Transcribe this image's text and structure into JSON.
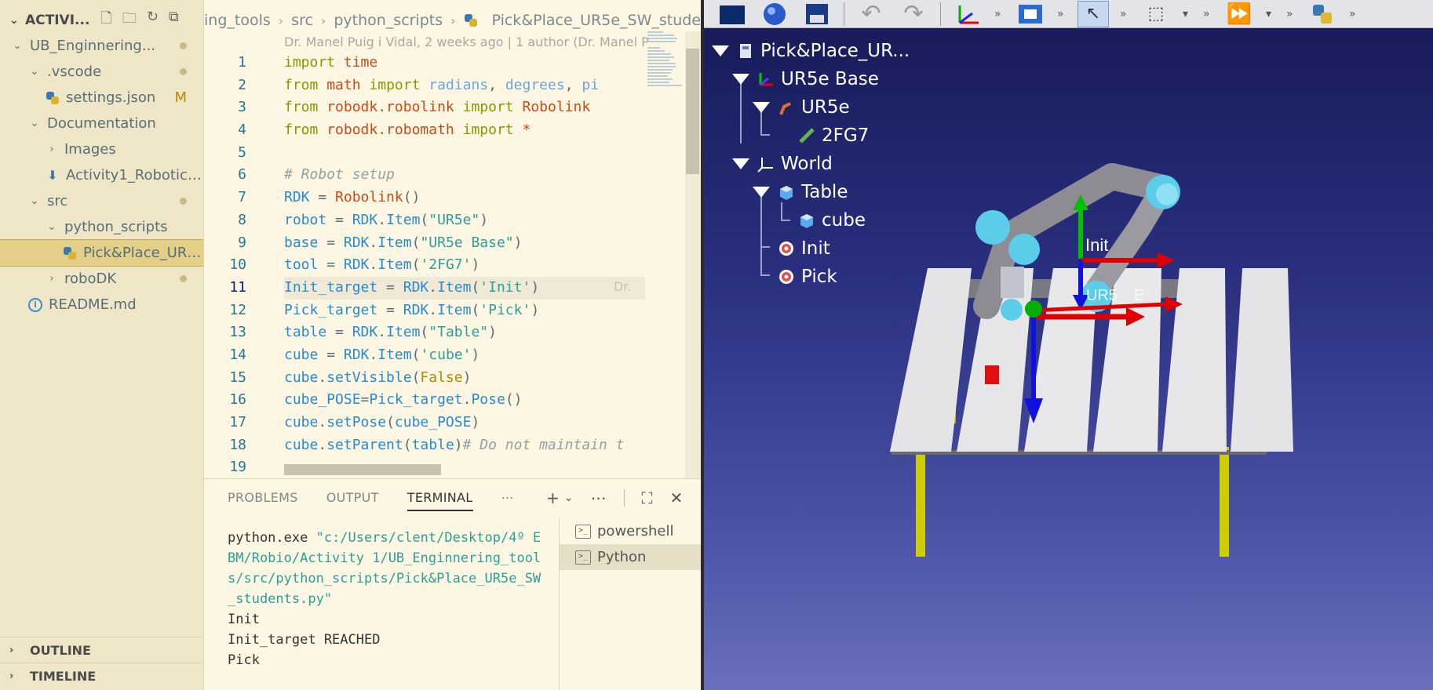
{
  "sidebar": {
    "header": "ACTIVI...",
    "items": [
      {
        "label": "UB_Enginnering...",
        "indent": 0,
        "twisty": "expanded",
        "badge": "dot"
      },
      {
        "label": ".vscode",
        "indent": 1,
        "twisty": "expanded",
        "badge": "dot"
      },
      {
        "label": "settings.json",
        "indent": 2,
        "twisty": "none",
        "icon": "python-icon",
        "badge": "M"
      },
      {
        "label": "Documentation",
        "indent": 1,
        "twisty": "expanded",
        "badge": ""
      },
      {
        "label": "Images",
        "indent": 2,
        "twisty": "collapsed",
        "badge": ""
      },
      {
        "label": "Activity1_Robotic_E...",
        "indent": 2,
        "twisty": "none",
        "icon": "download-icon",
        "badge": ""
      },
      {
        "label": "src",
        "indent": 1,
        "twisty": "expanded",
        "badge": "dot"
      },
      {
        "label": "python_scripts",
        "indent": 2,
        "twisty": "expanded",
        "badge": ""
      },
      {
        "label": "Pick&Place_UR5e...",
        "indent": 3,
        "twisty": "none",
        "icon": "python-icon",
        "badge": "",
        "selected": true
      },
      {
        "label": "roboDK",
        "indent": 2,
        "twisty": "collapsed",
        "badge": "dot"
      },
      {
        "label": "README.md",
        "indent": 1,
        "twisty": "none",
        "icon": "info-icon",
        "badge": ""
      }
    ],
    "outline": "OUTLINE",
    "timeline": "TIMELINE"
  },
  "editor": {
    "breadcrumb": [
      "ing_tools",
      "src",
      "python_scripts",
      "Pick&Place_UR5e_SW_students.py"
    ],
    "blame_header": "Dr. Manel Puig i Vidal, 2 weeks ago | 1 author (Dr. Manel P",
    "inline_blame": "Dr.",
    "line_numbers": [
      "1",
      "2",
      "3",
      "4",
      "5",
      "6",
      "7",
      "8",
      "9",
      "10",
      "11",
      "12",
      "13",
      "14",
      "15",
      "16",
      "17",
      "18",
      "19"
    ]
  },
  "panel": {
    "tabs": [
      "PROBLEMS",
      "OUTPUT",
      "TERMINAL"
    ],
    "active_tab": "TERMINAL",
    "terminal_cmd": "python.exe ",
    "terminal_path": "\"c:/Users/clent/Desktop/4º EBM/Robio/Activity 1/UB_Enginnering_tools/src/python_scripts/Pick&Place_UR5e_SW_students.py\"",
    "terminal_output": [
      "Init",
      "Init_target REACHED",
      "Pick"
    ],
    "terminals": [
      "powershell",
      "Python"
    ]
  },
  "robodk": {
    "tree": [
      {
        "label": "Pick&Place_UR...",
        "indent": 0,
        "icon": "station-icon",
        "twisty": true
      },
      {
        "label": "UR5e Base",
        "indent": 1,
        "icon": "frame-icon",
        "twisty": true
      },
      {
        "label": "UR5e",
        "indent": 2,
        "icon": "robot-icon",
        "twisty": true
      },
      {
        "label": "2FG7",
        "indent": 3,
        "icon": "tool-icon",
        "twisty": false
      },
      {
        "label": "World",
        "indent": 1,
        "icon": "axes-icon",
        "twisty": true
      },
      {
        "label": "Table",
        "indent": 2,
        "icon": "cube-icon",
        "twisty": true
      },
      {
        "label": "cube",
        "indent": 3,
        "icon": "cube-icon",
        "twisty": false
      },
      {
        "label": "Init",
        "indent": 2,
        "icon": "target-icon",
        "twisty": false
      },
      {
        "label": "Pick",
        "indent": 2,
        "icon": "target-icon",
        "twisty": false
      }
    ],
    "scene_labels": {
      "init": "Init",
      "ur5": "UR5",
      "e": "E"
    }
  }
}
